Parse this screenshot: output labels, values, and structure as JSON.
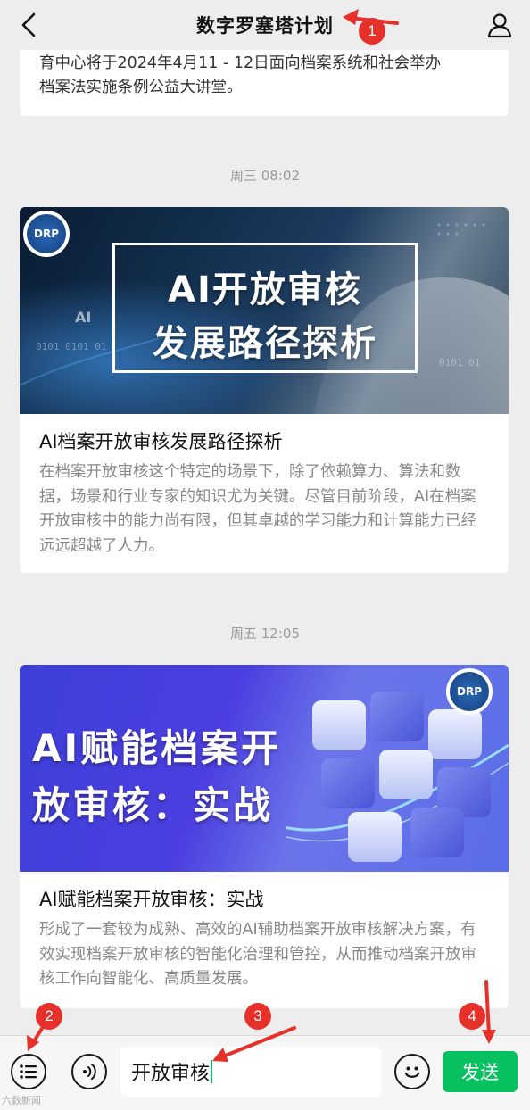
{
  "header": {
    "title": "数字罗塞塔计划",
    "back_icon": "chevron-left-icon",
    "profile_icon": "person-icon"
  },
  "feed": {
    "partial_message": {
      "text_line1": "育中心将于2024年4月11 - 12日面向档案系统和社会举办",
      "text_line2": "档案法实施条例公益大讲堂。"
    },
    "messages": [
      {
        "timestamp": "周三 08:02",
        "cover_line1": "AI开放审核",
        "cover_line2": "发展路径探析",
        "cover_small_text": "AI",
        "logo_text": "DRP",
        "title": "AI档案开放审核发展路径探析",
        "description": "在档案开放审核这个特定的场景下，除了依赖算力、算法和数据，场景和行业专家的知识尤为关键。尽管目前阶段，AI在档案开放审核中的能力尚有限，但其卓越的学习能力和计算能力已经远远超越了人力。"
      },
      {
        "timestamp": "周五 12:05",
        "cover_line1": "AI赋能档案开",
        "cover_line2": "放审核：实战",
        "logo_text": "DRP",
        "title": "AI赋能档案开放审核：实战",
        "description": "形成了一套较为成熟、高效的AI辅助档案开放审核解决方案，有效实现档案开放审核的智能化治理和管控，从而推动档案开放审核工作向智能化、高质量发展。"
      }
    ]
  },
  "input_bar": {
    "menu_icon": "list-menu-icon",
    "voice_icon": "voice-icon",
    "input_value": "开放审核",
    "emoji_icon": "emoji-icon",
    "send_label": "发送"
  },
  "annotations": {
    "markers": [
      "1",
      "2",
      "3",
      "4"
    ],
    "color": "#e5312a"
  },
  "watermark": "六数新闻",
  "colors": {
    "accent": "#07c160",
    "background": "#ededed",
    "annotation": "#e5312a"
  }
}
